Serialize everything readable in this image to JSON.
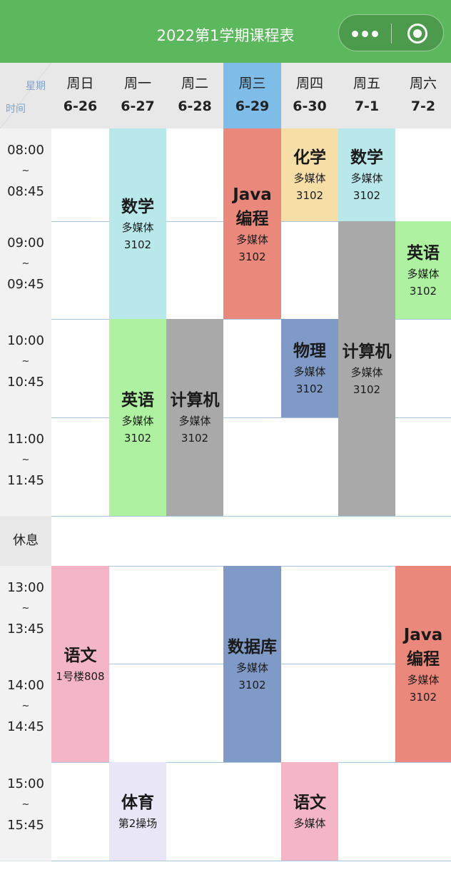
{
  "header": {
    "title": "2022第1学期课程表",
    "bar_color": "#5cb85c",
    "more_icon": "more-dots-icon",
    "close_icon": "target-close-icon"
  },
  "corner": {
    "week_label": "星期",
    "time_label": "时间"
  },
  "days": [
    {
      "name": "周日",
      "date": "6-26",
      "today": false
    },
    {
      "name": "周一",
      "date": "6-27",
      "today": false
    },
    {
      "name": "周二",
      "date": "6-28",
      "today": false
    },
    {
      "name": "周三",
      "date": "6-29",
      "today": true
    },
    {
      "name": "周四",
      "date": "6-30",
      "today": false
    },
    {
      "name": "周五",
      "date": "7-1",
      "today": false
    },
    {
      "name": "周六",
      "date": "7-2",
      "today": false
    }
  ],
  "periods": [
    {
      "start": "08:00",
      "sep": "~",
      "end": "08:45"
    },
    {
      "start": "09:00",
      "sep": "~",
      "end": "09:45"
    },
    {
      "start": "10:00",
      "sep": "~",
      "end": "10:45"
    },
    {
      "start": "11:00",
      "sep": "~",
      "end": "11:45"
    },
    {
      "break_label": "休息"
    },
    {
      "start": "13:00",
      "sep": "~",
      "end": "13:45"
    },
    {
      "start": "14:00",
      "sep": "~",
      "end": "14:45"
    },
    {
      "start": "15:00",
      "sep": "~",
      "end": "15:45"
    }
  ],
  "courses": [
    {
      "name": "数学",
      "location": "多媒体\n3102",
      "day": 1,
      "start": 0,
      "span": 2,
      "color": "#b8e8ea"
    },
    {
      "name": "Java编程",
      "location": "多媒体\n3102",
      "day": 3,
      "start": 0,
      "span": 2,
      "color": "#e9887b"
    },
    {
      "name": "化学",
      "location": "多媒体\n3102",
      "day": 4,
      "start": 0,
      "span": 1,
      "color": "#f6dfa6"
    },
    {
      "name": "数学",
      "location": "多媒体\n3102",
      "day": 5,
      "start": 0,
      "span": 1,
      "color": "#b8e8ea"
    },
    {
      "name": "英语",
      "location": "多媒体\n3102",
      "day": 6,
      "start": 1,
      "span": 1,
      "color": "#aef2a1"
    },
    {
      "name": "计算机",
      "location": "多媒体\n3102",
      "day": 5,
      "start": 1,
      "span": 3,
      "color": "#a9a9a9"
    },
    {
      "name": "英语",
      "location": "多媒体\n3102",
      "day": 1,
      "start": 2,
      "span": 2,
      "color": "#aef2a1"
    },
    {
      "name": "计算机",
      "location": "多媒体\n3102",
      "day": 2,
      "start": 2,
      "span": 2,
      "color": "#a9a9a9"
    },
    {
      "name": "物理",
      "location": "多媒体\n3102",
      "day": 4,
      "start": 2,
      "span": 1,
      "color": "#7f9ac6"
    },
    {
      "name": "语文",
      "location": "1号楼808",
      "day": 0,
      "start": 5,
      "span": 2,
      "color": "#f4b6c6"
    },
    {
      "name": "数据库",
      "location": "多媒体\n3102",
      "day": 3,
      "start": 5,
      "span": 2,
      "color": "#7f9ac6"
    },
    {
      "name": "Java编程",
      "location": "多媒体\n3102",
      "day": 6,
      "start": 5,
      "span": 2,
      "color": "#e9887b"
    },
    {
      "name": "体育",
      "location": "第2操场",
      "day": 1,
      "start": 7,
      "span": 1,
      "color": "#e8e6f7"
    },
    {
      "name": "语文",
      "location": "多媒体",
      "day": 4,
      "start": 7,
      "span": 2,
      "color": "#f4b6c6"
    }
  ]
}
